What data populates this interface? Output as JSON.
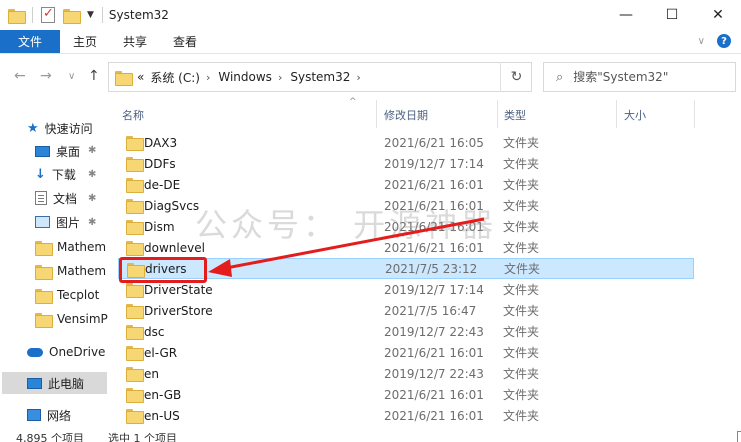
{
  "window": {
    "title": "System32",
    "controls": {
      "minimize": "—",
      "maximize": "☐",
      "close": "✕"
    }
  },
  "ribbon": {
    "tabs": [
      {
        "label": "文件",
        "active": true
      },
      {
        "label": "主页"
      },
      {
        "label": "共享"
      },
      {
        "label": "查看"
      }
    ],
    "expand_glyph": "∨",
    "help_glyph": "?"
  },
  "nav": {
    "back": "←",
    "forward": "→",
    "recent": "∨",
    "up": "↑"
  },
  "address": {
    "overflow": "«",
    "crumbs": [
      "系统 (C:)",
      "Windows",
      "System32"
    ],
    "separator": "›",
    "dropdown": "∨",
    "refresh": "↻"
  },
  "search": {
    "placeholder": "搜索\"System32\"",
    "icon": "⌕"
  },
  "nav_pane": {
    "quick_access": "快速访问",
    "items": [
      {
        "label": "桌面",
        "icon": "desktop-icon",
        "pinned": true
      },
      {
        "label": "下载",
        "icon": "download-icon",
        "pinned": true
      },
      {
        "label": "文档",
        "icon": "document-icon",
        "pinned": true
      },
      {
        "label": "图片",
        "icon": "picture-icon",
        "pinned": true
      },
      {
        "label": "Mathem",
        "icon": "folder-icon"
      },
      {
        "label": "Mathem",
        "icon": "folder-icon"
      },
      {
        "label": "Tecplot",
        "icon": "folder-icon"
      },
      {
        "label": "VensimP",
        "icon": "folder-icon"
      }
    ],
    "onedrive": "OneDrive",
    "this_pc": "此电脑",
    "network": "网络",
    "pin_glyph": "✱"
  },
  "columns": {
    "name": "名称",
    "date": "修改日期",
    "type": "类型",
    "size": "大小",
    "sort_glyph": "^"
  },
  "files": [
    {
      "name": "DAX3",
      "date": "2021/6/21 16:05",
      "type": "文件夹"
    },
    {
      "name": "DDFs",
      "date": "2019/12/7 17:14",
      "type": "文件夹"
    },
    {
      "name": "de-DE",
      "date": "2021/6/21 16:01",
      "type": "文件夹"
    },
    {
      "name": "DiagSvcs",
      "date": "2021/6/21 16:01",
      "type": "文件夹"
    },
    {
      "name": "Dism",
      "date": "2021/6/21 16:01",
      "type": "文件夹"
    },
    {
      "name": "downlevel",
      "date": "2021/6/21 16:01",
      "type": "文件夹"
    },
    {
      "name": "drivers",
      "date": "2021/7/5 23:12",
      "type": "文件夹",
      "selected": true
    },
    {
      "name": "DriverState",
      "date": "2019/12/7 17:14",
      "type": "文件夹"
    },
    {
      "name": "DriverStore",
      "date": "2021/7/5 16:47",
      "type": "文件夹"
    },
    {
      "name": "dsc",
      "date": "2019/12/7 22:43",
      "type": "文件夹"
    },
    {
      "name": "el-GR",
      "date": "2021/6/21 16:01",
      "type": "文件夹"
    },
    {
      "name": "en",
      "date": "2019/12/7 22:43",
      "type": "文件夹"
    },
    {
      "name": "en-GB",
      "date": "2021/6/21 16:01",
      "type": "文件夹"
    },
    {
      "name": "en-US",
      "date": "2021/6/21 16:01",
      "type": "文件夹"
    }
  ],
  "status": {
    "item_count": "4,895 个项目",
    "selection": "选中 1 个项目"
  },
  "watermark": "公众号：  开源神器",
  "colors": {
    "file_tab": "#1a6fc9",
    "selection_bg": "#cce8ff",
    "annotation_red": "#e41c1c"
  }
}
